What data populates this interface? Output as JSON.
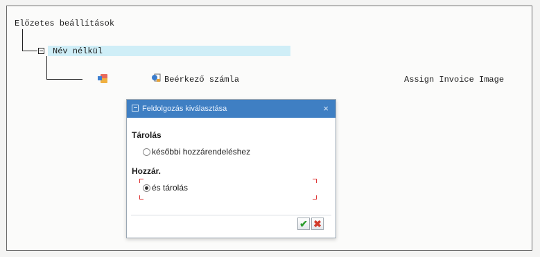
{
  "tree": {
    "root_label": "Előzetes beállítások",
    "node_label": "Név nélkül",
    "child_label": "Beérkező számla",
    "child_action": "Assign Invoice Image"
  },
  "dialog": {
    "title": "Feldolgozás kiválasztása",
    "close_glyph": "×",
    "section1_label": "Tárolás",
    "option1_label": "későbbi hozzárendeléshez",
    "section2_label": "Hozzár.",
    "option2_label": "és tárolás",
    "option_selected": "és tárolás",
    "ok_glyph": "✔",
    "cancel_glyph": "✖"
  },
  "icons": {
    "collapse": "collapse-icon",
    "document": "document-icon",
    "invoice": "invoice-icon",
    "dialog": "dialog-icon"
  },
  "colors": {
    "title_bar": "#3f7fc3",
    "highlight": "#cfeef7",
    "ok_green": "#2e9d2e",
    "cancel_red": "#d23a2a",
    "focus_red": "#dd3333"
  }
}
